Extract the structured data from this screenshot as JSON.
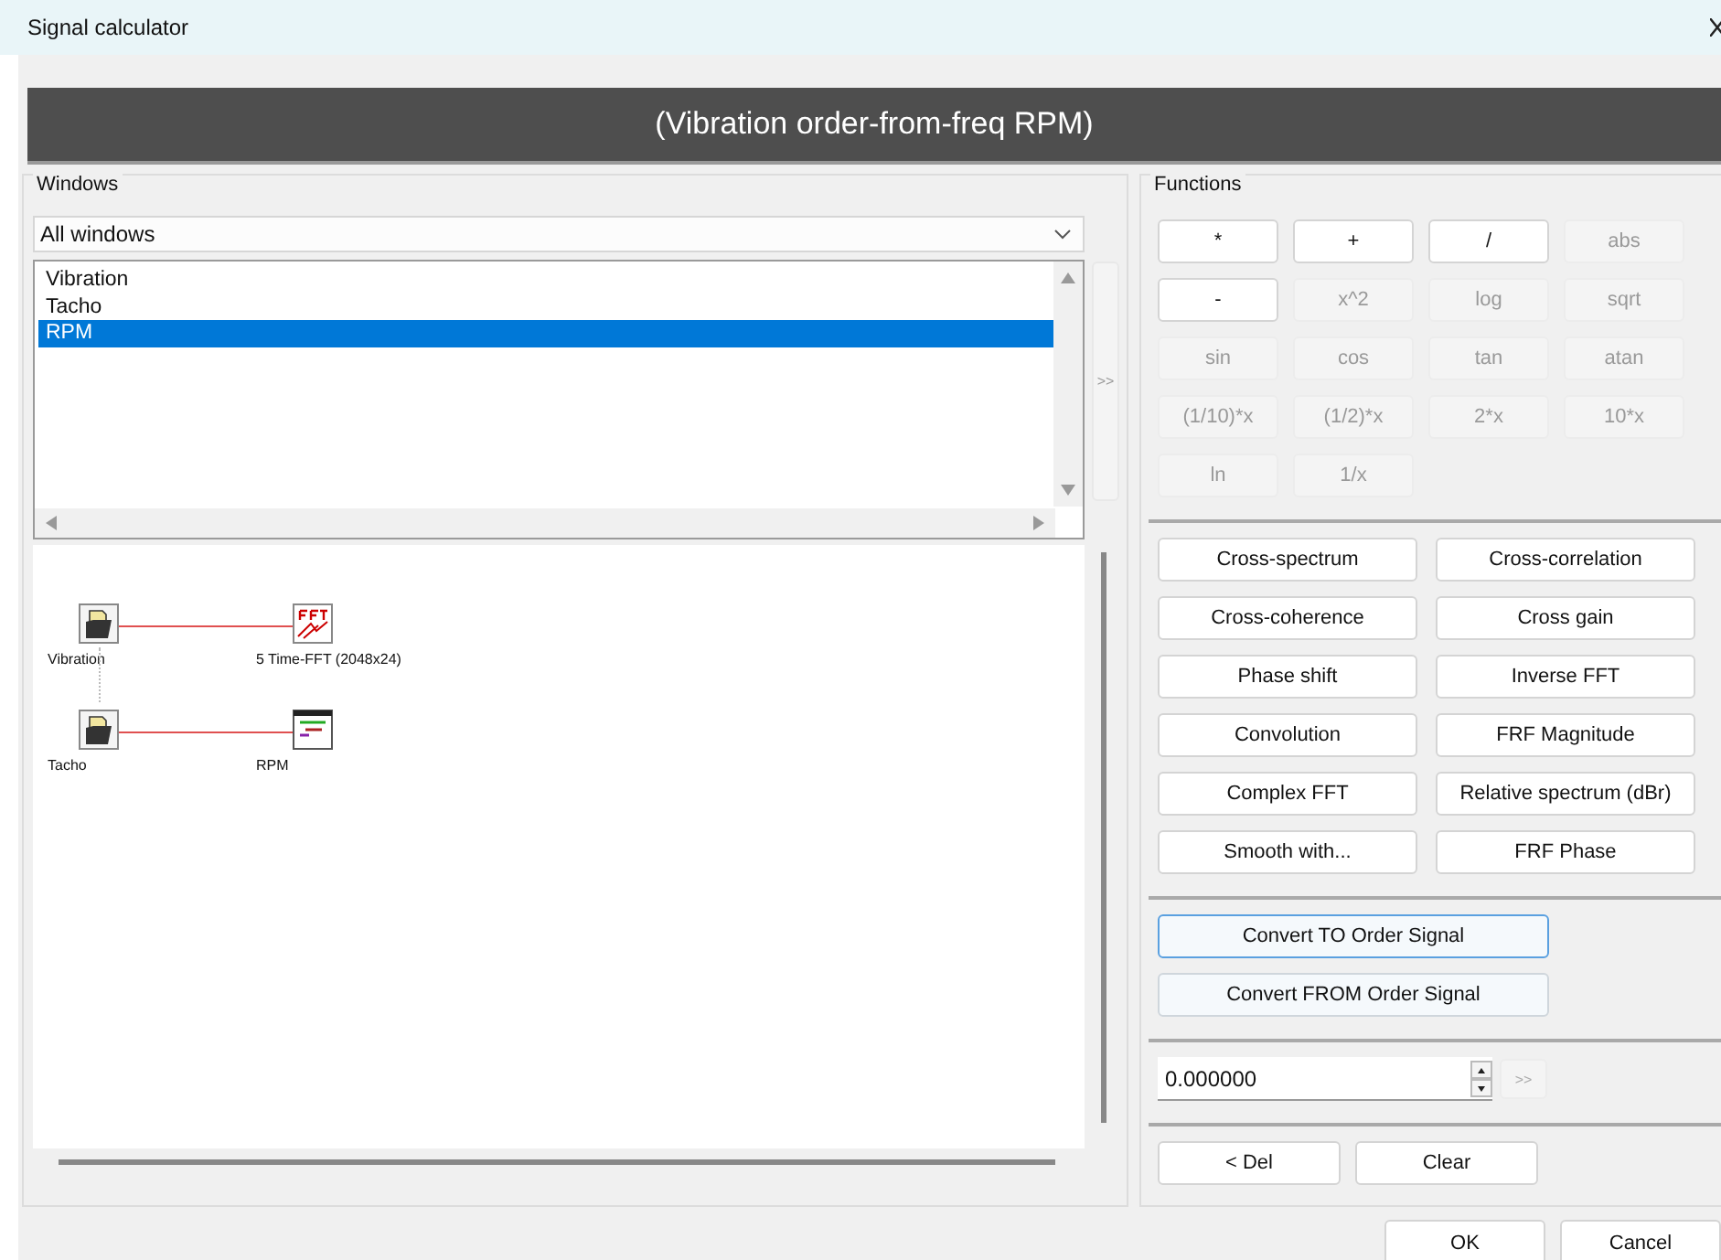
{
  "window": {
    "title": "Signal calculator"
  },
  "expression": "(Vibration order-from-freq RPM)",
  "windows": {
    "legend": "Windows",
    "filter": {
      "value": "All windows"
    },
    "list": [
      {
        "label": "Vibration",
        "selected": false
      },
      {
        "label": "Tacho",
        "selected": false
      },
      {
        "label": "RPM",
        "selected": true
      }
    ],
    "add_button": {
      "label": ">>",
      "disabled": true
    },
    "diagram": [
      {
        "source": {
          "label": "Vibration",
          "kind": "file"
        },
        "target": {
          "label": "5 Time-FFT (2048x24)",
          "kind": "fft"
        }
      },
      {
        "source": {
          "label": "Tacho",
          "kind": "file"
        },
        "target": {
          "label": "RPM",
          "kind": "display"
        }
      }
    ]
  },
  "functions": {
    "legend": "Functions",
    "operators": [
      {
        "label": "*",
        "disabled": false
      },
      {
        "label": "+",
        "disabled": false
      },
      {
        "label": "/",
        "disabled": false
      },
      {
        "label": "abs",
        "disabled": true
      },
      {
        "label": "-",
        "disabled": false
      },
      {
        "label": "x^2",
        "disabled": true
      },
      {
        "label": "log",
        "disabled": true
      },
      {
        "label": "sqrt",
        "disabled": true
      },
      {
        "label": "sin",
        "disabled": true
      },
      {
        "label": "cos",
        "disabled": true
      },
      {
        "label": "tan",
        "disabled": true
      },
      {
        "label": "atan",
        "disabled": true
      },
      {
        "label": "(1/10)*x",
        "disabled": true
      },
      {
        "label": "(1/2)*x",
        "disabled": true
      },
      {
        "label": "2*x",
        "disabled": true
      },
      {
        "label": "10*x",
        "disabled": true
      },
      {
        "label": "ln",
        "disabled": true
      },
      {
        "label": "1/x",
        "disabled": true
      }
    ],
    "operations": [
      {
        "label": "Cross-spectrum"
      },
      {
        "label": "Cross-correlation"
      },
      {
        "label": "Cross-coherence"
      },
      {
        "label": "Cross gain"
      },
      {
        "label": "Phase shift"
      },
      {
        "label": "Inverse FFT"
      },
      {
        "label": "Convolution"
      },
      {
        "label": "FRF Magnitude"
      },
      {
        "label": "Complex FFT"
      },
      {
        "label": "Relative spectrum (dBr)"
      },
      {
        "label": "Smooth with..."
      },
      {
        "label": "FRF Phase"
      }
    ],
    "order_buttons": [
      {
        "label": "Convert TO Order Signal",
        "focused": true
      },
      {
        "label": "Convert FROM Order Signal",
        "focused": false
      }
    ],
    "constant": {
      "value": "0.000000"
    },
    "constant_add": {
      "label": ">>",
      "disabled": true
    },
    "edit_buttons": [
      {
        "label": "< Del"
      },
      {
        "label": "Clear"
      }
    ]
  },
  "buttons": [
    {
      "label": "OK"
    },
    {
      "label": "Cancel"
    }
  ]
}
